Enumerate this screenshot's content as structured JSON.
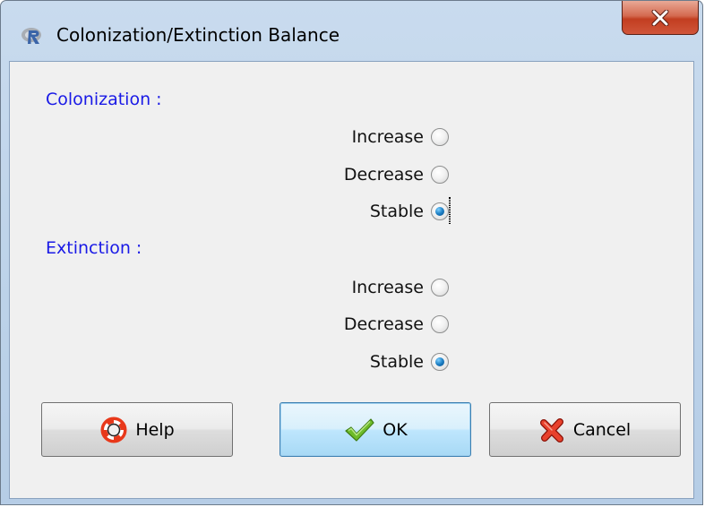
{
  "window": {
    "title": "Colonization/Extinction Balance",
    "close_icon": "close-icon",
    "app_icon": "r-logo-icon"
  },
  "colonization": {
    "label": "Colonization :",
    "options": [
      {
        "label": "Increase",
        "checked": false
      },
      {
        "label": "Decrease",
        "checked": false
      },
      {
        "label": "Stable",
        "checked": true
      }
    ]
  },
  "extinction": {
    "label": "Extinction :",
    "options": [
      {
        "label": "Increase",
        "checked": false
      },
      {
        "label": "Decrease",
        "checked": false
      },
      {
        "label": "Stable",
        "checked": true
      }
    ]
  },
  "buttons": {
    "help": {
      "label": "Help",
      "icon": "lifebuoy-icon"
    },
    "ok": {
      "label": "OK",
      "icon": "checkmark-icon"
    },
    "cancel": {
      "label": "Cancel",
      "icon": "red-x-icon"
    }
  },
  "colors": {
    "section_label": "#1a1ae6",
    "radio_checked": "#1d7fc4",
    "close_button": "#c23e20"
  }
}
